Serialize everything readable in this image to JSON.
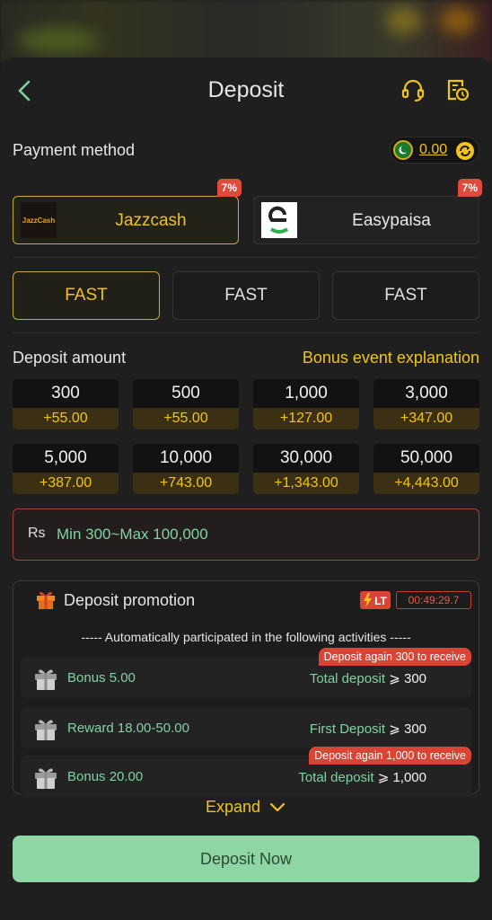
{
  "header": {
    "title": "Deposit",
    "back_icon": "chevron-left-icon",
    "support_icon": "headset-icon",
    "history_icon": "history-icon"
  },
  "payment": {
    "label": "Payment method",
    "balance": "0.00",
    "methods": [
      {
        "name": "Jazzcash",
        "badge": "7%",
        "selected": true,
        "logo": "JazzCash"
      },
      {
        "name": "Easypaisa",
        "badge": "7%",
        "selected": false
      }
    ]
  },
  "channels": [
    {
      "label": "FAST",
      "selected": true
    },
    {
      "label": "FAST",
      "selected": false
    },
    {
      "label": "FAST",
      "selected": false
    }
  ],
  "amounts": {
    "label": "Deposit amount",
    "bonus_link": "Bonus event explanation",
    "tiles": [
      {
        "amount": "300",
        "bonus": "+55.00"
      },
      {
        "amount": "500",
        "bonus": "+55.00"
      },
      {
        "amount": "1,000",
        "bonus": "+127.00"
      },
      {
        "amount": "3,000",
        "bonus": "+347.00"
      },
      {
        "amount": "5,000",
        "bonus": "+387.00"
      },
      {
        "amount": "10,000",
        "bonus": "+743.00"
      },
      {
        "amount": "30,000",
        "bonus": "+1,343.00"
      },
      {
        "amount": "50,000",
        "bonus": "+4,443.00"
      }
    ]
  },
  "input": {
    "currency": "Rs",
    "placeholder": "Min 300~Max 100,000"
  },
  "promotion": {
    "title": "Deposit promotion",
    "lt_badge": "LT",
    "timer": "00:49:29.7",
    "note": "----- Automatically participated in the following activities -----",
    "activities": [
      {
        "name": "Bonus 5.00",
        "cond_text": "Total deposit",
        "cond_value": "⩾ 300",
        "tag": "Deposit again 300 to receive"
      },
      {
        "name": "Reward 18.00-50.00",
        "cond_text": "First Deposit",
        "cond_value": "⩾ 300",
        "tag": ""
      },
      {
        "name": "Bonus 20.00",
        "cond_text": "Total deposit",
        "cond_value": "⩾ 1,000",
        "tag": "Deposit again 1,000 to receive"
      }
    ]
  },
  "expand_label": "Expand",
  "deposit_button": "Deposit Now",
  "colors": {
    "accent": "#f0c419",
    "green_text": "#7fd3a0",
    "button": "#8ed6a4",
    "badge": "#e04a3a"
  }
}
